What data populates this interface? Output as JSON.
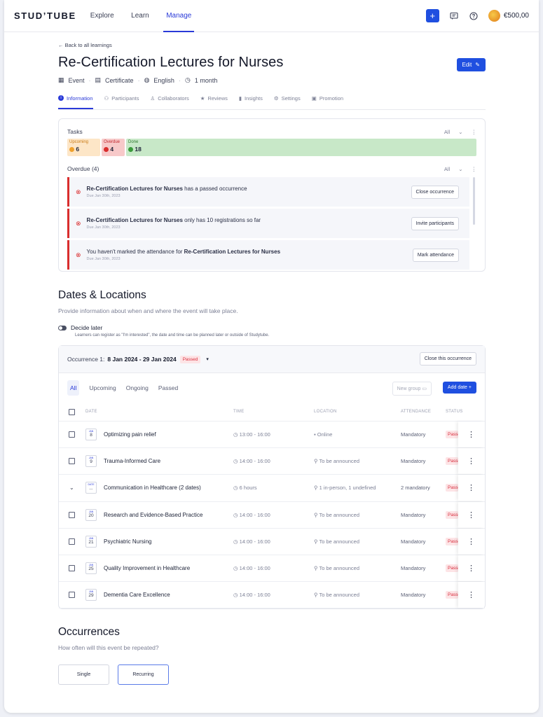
{
  "app": {
    "logo": "STUD’TUBE",
    "nav": [
      "Explore",
      "Learn",
      "Manage"
    ],
    "active_nav": "Manage",
    "balance": "€500,00"
  },
  "page": {
    "back_link": "Back to all learnings",
    "title": "Re-Certification Lectures for Nurses",
    "edit_label": "Edit",
    "meta": [
      "Event",
      "Certificate",
      "English",
      "1 month"
    ],
    "tabs": [
      "Information",
      "Participants",
      "Collaborators",
      "Reviews",
      "Insights",
      "Settings",
      "Promotion"
    ],
    "active_tab": "Information"
  },
  "tasks": {
    "title": "Tasks",
    "filter": "All",
    "segments": [
      {
        "label": "Upcoming",
        "count": "6",
        "color": "#fde6c7"
      },
      {
        "label": "Overdue",
        "count": "4",
        "color": "#f7c9c9"
      },
      {
        "label": "Done",
        "count": "18",
        "color": "#c8e8c8"
      }
    ],
    "overdue_title": "Overdue (4)",
    "overdue_filter": "All",
    "overdue_items": [
      {
        "bold": "Re-Certification Lectures for Nurses",
        "text": " has a passed occurrence",
        "due": "Due Jan 30th, 2023",
        "button": "Close occurrence"
      },
      {
        "bold": "Re-Certification Lectures for Nurses",
        "text": " only has 10 registrations so far",
        "due": "Due Jan 30th, 2023",
        "button": "Invite participants"
      },
      {
        "prefix": "You haven't marked the attendance for ",
        "bold": "Re-Certification Lectures for Nurses",
        "due": "Due Jan 30th, 2023",
        "button": "Mark attendance"
      }
    ]
  },
  "dates": {
    "title": "Dates & Locations",
    "subtitle": "Provide information about when and where the event will take place.",
    "decide_label": "Decide later",
    "decide_sub": "Learners can register as \"I'm interested\", the date and time can be planned later or outside of Studytube.",
    "occurrence_label": "Occurrence 1:",
    "occurrence_range": "8 Jan 2024 - 29 Jan 2024",
    "occurrence_status": "Passed",
    "close_btn": "Close this occurrence",
    "filters": [
      "All",
      "Upcoming",
      "Ongoing",
      "Passed"
    ],
    "new_group": "New group",
    "add_date": "Add date",
    "columns": [
      "DATE",
      "TIME",
      "LOCATION",
      "ATTENDANCE",
      "STATUS"
    ],
    "rows": [
      {
        "month": "JAN",
        "day": "8",
        "name": "Optimizing pain relief",
        "time": "13:00 - 16:00",
        "location": "Online",
        "attendance": "Mandatory",
        "status": "Passed",
        "type": "check"
      },
      {
        "month": "JAN",
        "day": "9",
        "name": "Trauma-Informed Care",
        "time": "14:00 - 16:00",
        "location": "To be announced",
        "attendance": "Mandatory",
        "status": "Passed",
        "type": "check"
      },
      {
        "month": "DATE",
        "day": "...",
        "name": "Communication in Healthcare (2 dates)",
        "time": "6 hours",
        "location": "1 in-person, 1 undefined",
        "attendance": "2 mandatory",
        "status": "Passed",
        "type": "group"
      },
      {
        "month": "JAN",
        "day": "20",
        "name": "Research and Evidence-Based Practice",
        "time": "14:00 - 16:00",
        "location": "To be announced",
        "attendance": "Mandatory",
        "status": "Passed",
        "type": "check"
      },
      {
        "month": "JAN",
        "day": "21",
        "name": "Psychiatric Nursing",
        "time": "14:00 - 16:00",
        "location": "To be announced",
        "attendance": "Mandatory",
        "status": "Passed",
        "type": "check"
      },
      {
        "month": "JAN",
        "day": "25",
        "name": "Quality Improvement in Healthcare",
        "time": "14:00 - 16:00",
        "location": "To be announced",
        "attendance": "Mandatory",
        "status": "Passed",
        "type": "check"
      },
      {
        "month": "JAN",
        "day": "29",
        "name": "Dementia Care Excellence",
        "time": "14:00 - 16:00",
        "location": "To be announced",
        "attendance": "Mandatory",
        "status": "Passed",
        "type": "check"
      }
    ]
  },
  "occurrences": {
    "title": "Occurrences",
    "subtitle": "How often will this event be repeated?",
    "options": [
      "Single",
      "Recurring"
    ],
    "selected": "Recurring"
  }
}
